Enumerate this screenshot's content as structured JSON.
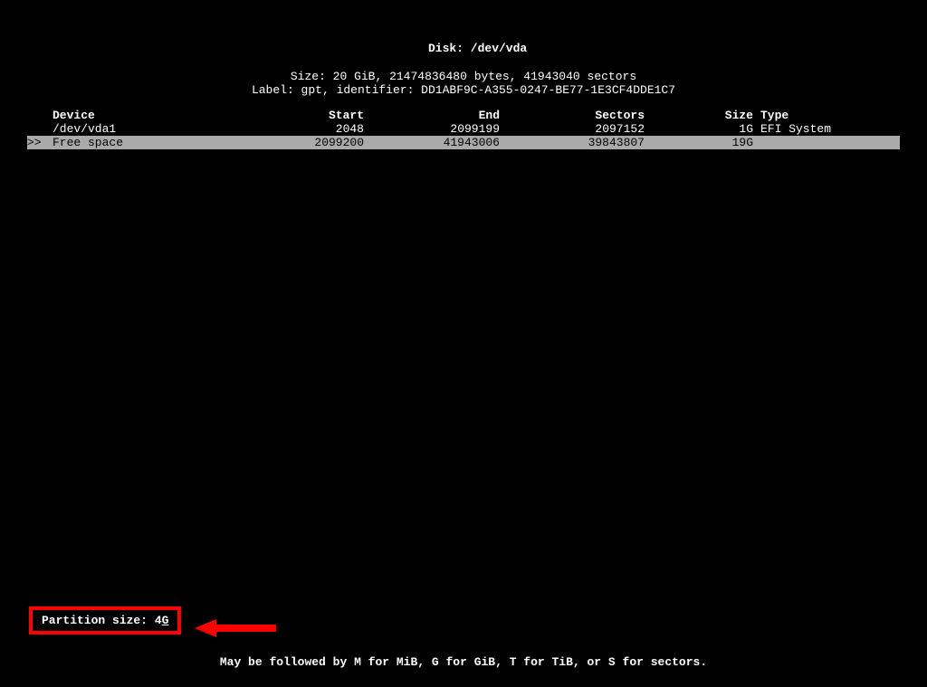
{
  "header": {
    "disk_label_prefix": "Disk: ",
    "disk_path": "/dev/vda",
    "size_line": "Size: 20 GiB, 21474836480 bytes, 41943040 sectors",
    "label_line": "Label: gpt, identifier: DD1ABF9C-A355-0247-BE77-1E3CF4DDE1C7"
  },
  "table": {
    "headers": {
      "device": "Device",
      "start": "Start",
      "end": "End",
      "sectors": "Sectors",
      "size": "Size",
      "type": "Type"
    },
    "rows": [
      {
        "indicator": "",
        "device": "/dev/vda1",
        "start": "2048",
        "end": "2099199",
        "sectors": "2097152",
        "size": "1G",
        "type": "EFI System",
        "selected": false
      },
      {
        "indicator": ">>",
        "device": "Free space",
        "start": "2099200",
        "end": "41943006",
        "sectors": "39843807",
        "size": "19G",
        "type": "",
        "selected": true
      }
    ]
  },
  "prompt": {
    "label": "Partition size: ",
    "value_prefix": "4",
    "value_underlined": "G"
  },
  "hint": "May be followed by M for MiB, G for GiB, T for TiB, or S for sectors."
}
